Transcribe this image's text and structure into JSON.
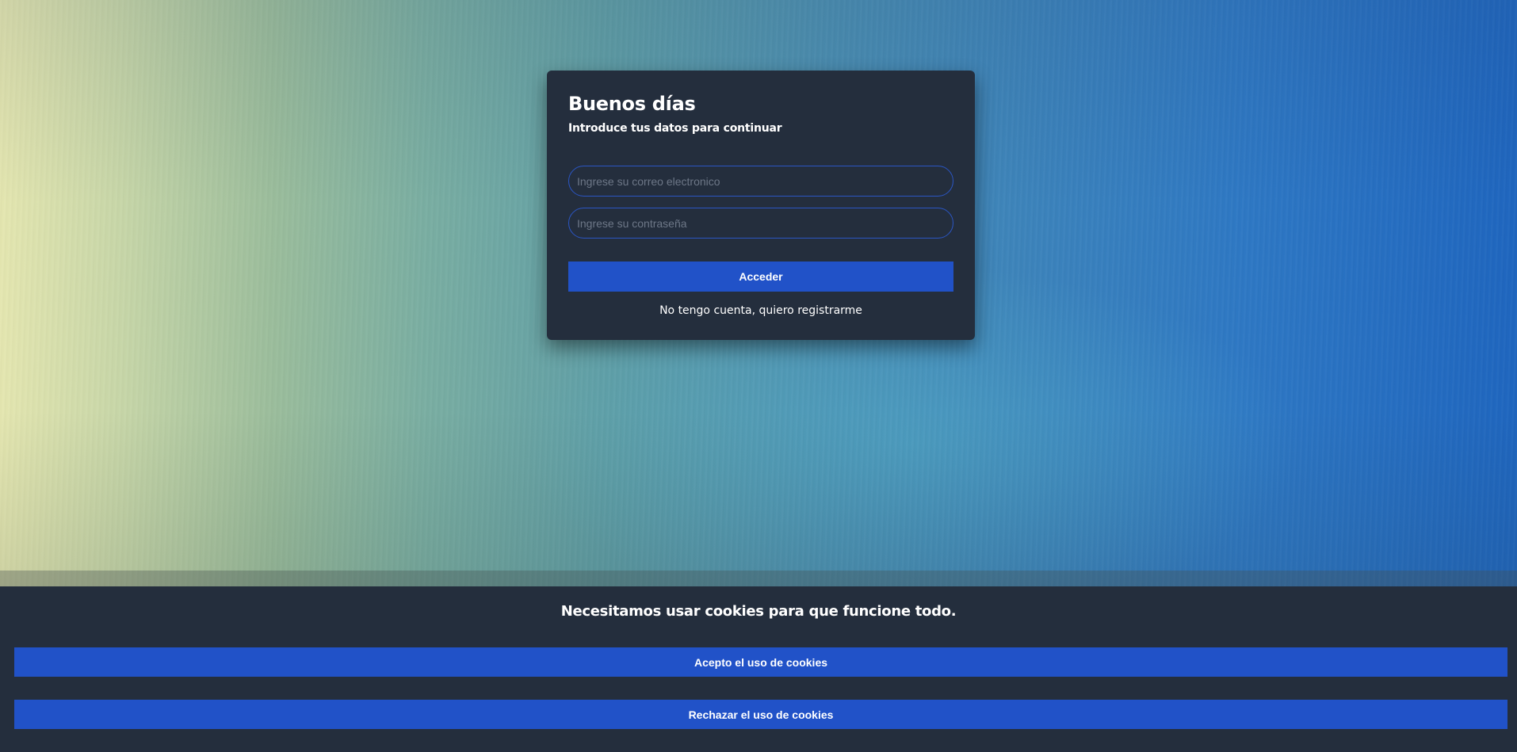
{
  "login": {
    "title": "Buenos días",
    "subtitle": "Introduce tus datos para continuar",
    "email_placeholder": "Ingrese su correo electronico",
    "password_placeholder": "Ingrese su contraseña",
    "submit_label": "Acceder",
    "register_link": "No tengo cuenta, quiero registrarme"
  },
  "cookies": {
    "message": "Necesitamos usar cookies para que funcione todo.",
    "accept_label": "Acepto el uso de cookies",
    "reject_label": "Rechazar el uso de cookies"
  },
  "colors": {
    "card_background": "#242e3d",
    "accent": "#2152c8",
    "input_border": "#2b56c4"
  }
}
